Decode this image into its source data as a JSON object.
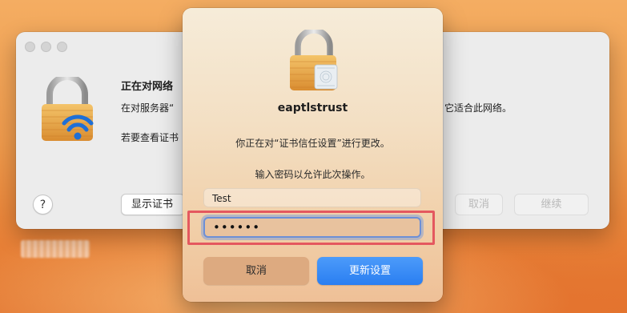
{
  "background_window": {
    "title": "正在对网络",
    "message_left": "在对服务器“",
    "message_right": "它适合此网络。",
    "cert_prompt": "若要查看证书",
    "help_label": "?",
    "show_cert_label": "显示证书",
    "cancel_label": "取消",
    "continue_label": "继续"
  },
  "auth_dialog": {
    "app_name": "eaptlstrust",
    "message": "你正在对“证书信任设置”进行更改。",
    "prompt": "输入密码以允许此次操作。",
    "username_value": "Test",
    "password_value": "••••••",
    "cancel_label": "取消",
    "confirm_label": "更新设置"
  },
  "colors": {
    "accent_blue": "#2a7ef1",
    "highlight_red": "#e4585f",
    "lock_gold": "#e8a64a",
    "wifi_blue": "#1f6fd6"
  },
  "icons": {
    "background_window": "lock-wifi-icon",
    "auth_dialog": "lock-certificate-icon"
  }
}
